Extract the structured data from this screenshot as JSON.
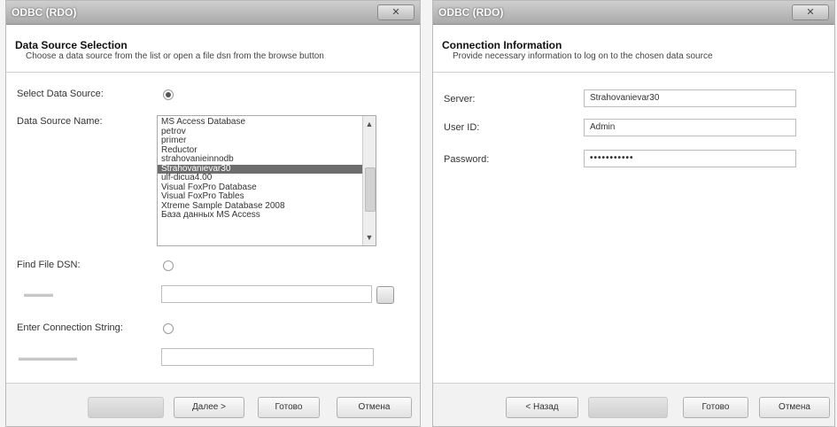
{
  "left_dialog": {
    "title": "ODBC (RDO)",
    "header": {
      "title": "Data Source Selection",
      "subtitle": "Choose a data source from the list or open a file dsn from the browse button"
    },
    "labels": {
      "select_data_source": "Select Data Source:",
      "data_source_name": "Data Source Name:",
      "find_file_dsn": "Find File DSN:",
      "enter_connection_string": "Enter Connection String:"
    },
    "data_sources": [
      "MS Access Database",
      "petrov",
      "primer",
      "Reductor",
      "strahovanieinnodb",
      "Strahovanievar30",
      "ulf-dicua4.00",
      "Visual FoxPro Database",
      "Visual FoxPro Tables",
      "Xtreme Sample Database 2008",
      "База данных MS Access"
    ],
    "selected_data_source": "Strahovanievar30",
    "buttons": {
      "next": "Далее >",
      "finish": "Готово",
      "cancel": "Отмена"
    }
  },
  "right_dialog": {
    "title": "ODBC (RDO)",
    "header": {
      "title": "Connection Information",
      "subtitle": "Provide necessary information to log on to the chosen data source"
    },
    "labels": {
      "server": "Server:",
      "user_id": "User ID:",
      "password": "Password:"
    },
    "values": {
      "server": "Strahovanievar30",
      "user_id": "Admin",
      "password": "•••••••••••"
    },
    "buttons": {
      "back": "< Назад",
      "finish": "Готово",
      "cancel": "Отмена"
    }
  }
}
